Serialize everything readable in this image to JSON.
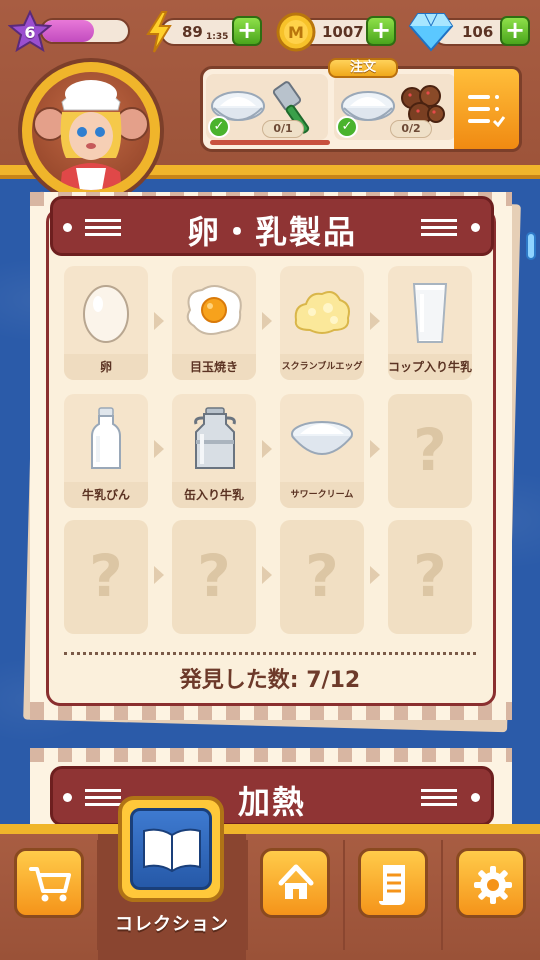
{
  "hud": {
    "level": "6",
    "xp_fraction": 0.6,
    "energy": "89",
    "energy_timer": "1:35",
    "coins": "1007",
    "gems": "106",
    "plus": "+"
  },
  "order": {
    "tab_label": "注文",
    "slots": [
      {
        "items": [
          "sour-cream-icon",
          "spatula-icon"
        ],
        "count": "0/1"
      },
      {
        "items": [
          "sour-cream-icon",
          "chocolate-balls-icon"
        ],
        "count": "0/2"
      }
    ]
  },
  "collection": {
    "category_title": "卵・乳製品",
    "rows": [
      [
        {
          "label": "卵",
          "icon": "egg-icon",
          "known": true
        },
        {
          "label": "目玉焼き",
          "icon": "fried-egg-icon",
          "known": true
        },
        {
          "label": "スクランブルエッグ",
          "icon": "scrambled-egg-icon",
          "known": true
        },
        {
          "label": "コップ入り牛乳",
          "icon": "glass-of-milk-icon",
          "known": true
        }
      ],
      [
        {
          "label": "牛乳びん",
          "icon": "milk-bottle-icon",
          "known": true
        },
        {
          "label": "缶入り牛乳",
          "icon": "milk-can-icon",
          "known": true
        },
        {
          "label": "サワークリーム",
          "icon": "sour-cream-icon",
          "known": true
        },
        {
          "label": "",
          "icon": "unknown-icon",
          "known": false
        }
      ],
      [
        {
          "label": "",
          "icon": "unknown-icon",
          "known": false
        },
        {
          "label": "",
          "icon": "unknown-icon",
          "known": false
        },
        {
          "label": "",
          "icon": "unknown-icon",
          "known": false
        },
        {
          "label": "",
          "icon": "unknown-icon",
          "known": false
        }
      ]
    ],
    "unknown_glyph": "?",
    "found_label": "発見した数: 7/12",
    "next_category_title": "加熱"
  },
  "nav": {
    "collection_label": "コレクション",
    "buttons": [
      "cart-icon",
      "home-icon",
      "scroll-icon",
      "gear-icon"
    ]
  },
  "colors": {
    "accent": "#f0b52b",
    "header_red": "#8f3434",
    "plus_green": "#4aa51c",
    "bar_brown": "#a35a3f"
  }
}
